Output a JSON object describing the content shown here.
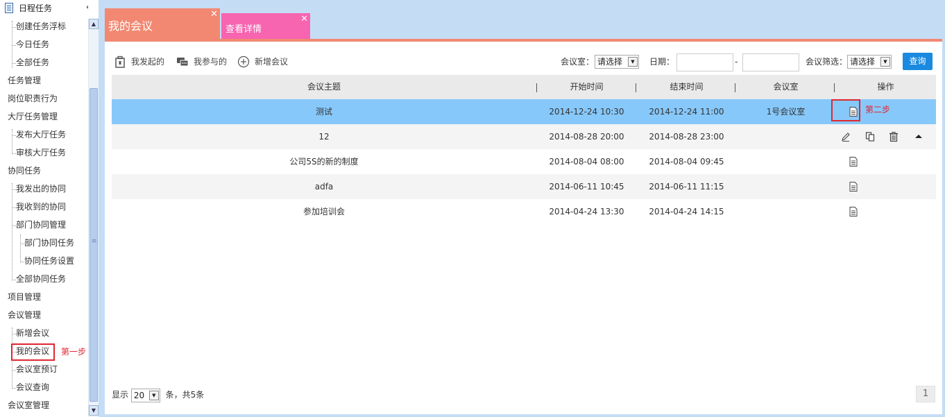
{
  "sidebar": {
    "header_title": "日程任务",
    "items": [
      {
        "label": "创建任务浮标"
      },
      {
        "label": "今日任务"
      },
      {
        "label": "全部任务"
      },
      {
        "label": "任务管理"
      },
      {
        "label": "岗位职责行为"
      },
      {
        "label": "大厅任务管理"
      },
      {
        "label": "发布大厅任务"
      },
      {
        "label": "审核大厅任务"
      },
      {
        "label": "协同任务"
      },
      {
        "label": "我发出的协同"
      },
      {
        "label": "我收到的协同"
      },
      {
        "label": "部门协同管理"
      },
      {
        "label": "部门协同任务"
      },
      {
        "label": "协同任务设置"
      },
      {
        "label": "全部协同任务"
      },
      {
        "label": "项目管理"
      },
      {
        "label": "会议管理"
      },
      {
        "label": "新增会议"
      },
      {
        "label": "我的会议"
      },
      {
        "label": "会议室预订"
      },
      {
        "label": "会议查询"
      },
      {
        "label": "会议室管理"
      }
    ],
    "step1_label": "第一步"
  },
  "tabs": [
    {
      "label": "我的会议"
    },
    {
      "label": "查看详情"
    }
  ],
  "toolbar": {
    "initiated_label": "我发起的",
    "participated_label": "我参与的",
    "new_meeting_label": "新增会议",
    "room_label": "会议室：",
    "room_value": "请选择",
    "date_label": "日期：",
    "date_sep": "-",
    "filter_label": "会议筛选：",
    "filter_value": "请选择",
    "query_label": "查询"
  },
  "table": {
    "headers": [
      "会议主题",
      "开始时间",
      "结束时间",
      "会议室",
      "操作"
    ],
    "rows": [
      {
        "topic": "测试",
        "start": "2014-12-24 10:30",
        "end": "2014-12-24 11:00",
        "room": "1号会议室"
      },
      {
        "topic": "12",
        "start": "2014-08-28 20:00",
        "end": "2014-08-28 23:00",
        "room": ""
      },
      {
        "topic": "公司5S的新的制度",
        "start": "2014-08-04 08:00",
        "end": "2014-08-04 09:45",
        "room": ""
      },
      {
        "topic": "adfa",
        "start": "2014-06-11 10:45",
        "end": "2014-06-11 11:15",
        "room": ""
      },
      {
        "topic": "参加培训会",
        "start": "2014-04-24 13:30",
        "end": "2014-04-24 14:15",
        "room": ""
      }
    ],
    "step2_label": "第二步"
  },
  "footer": {
    "show_label": "显示",
    "page_size": "20",
    "summary": "条，共5条",
    "page": "1"
  },
  "colors": {
    "tab_active": "#f28872",
    "tab_detail": "#f764b0",
    "selected_row": "#87c8fa",
    "query_button": "#1a8ae0",
    "annotation_red": "#e0262f"
  }
}
